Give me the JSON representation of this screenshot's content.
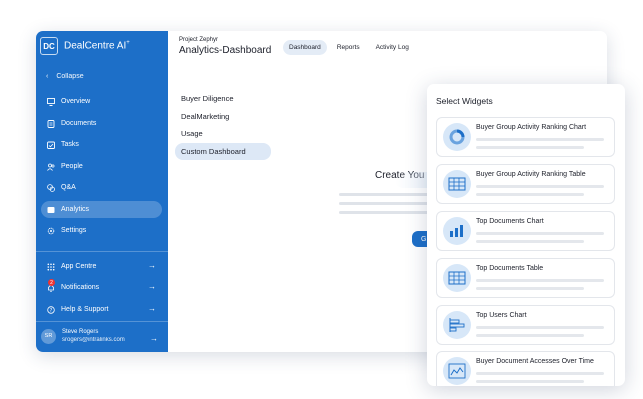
{
  "app": {
    "logo_initials": "DC",
    "logo_name": "DealCentre AI",
    "logo_sup": "+",
    "collapse": "Collapse"
  },
  "sidebar": {
    "items": [
      {
        "label": "Overview",
        "icon": "monitor-icon"
      },
      {
        "label": "Documents",
        "icon": "document-icon"
      },
      {
        "label": "Tasks",
        "icon": "tasks-icon"
      },
      {
        "label": "People",
        "icon": "people-icon"
      },
      {
        "label": "Q&A",
        "icon": "chat-icon"
      },
      {
        "label": "Analytics",
        "icon": "analytics-icon",
        "active": true
      },
      {
        "label": "Settings",
        "icon": "gear-icon"
      }
    ],
    "bottom": [
      {
        "label": "App Centre",
        "icon": "grid-icon"
      },
      {
        "label": "Notifications",
        "icon": "bell-icon",
        "badge": "2"
      },
      {
        "label": "Help & Support",
        "icon": "help-icon"
      }
    ],
    "user": {
      "initials": "SR",
      "name": "Steve Rogers",
      "email": "srogers@intralinks.com"
    }
  },
  "header": {
    "project": "Project Zephyr",
    "title": "Analytics-Dashboard",
    "tabs": [
      "Dashboard",
      "Reports",
      "Activity Log"
    ],
    "active_tab": "Dashboard"
  },
  "dashboards": [
    "Buyer Diligence",
    "DealMarketing",
    "Usage",
    "Custom Dashboard"
  ],
  "active_dashboard": "Custom Dashboard",
  "main": {
    "create_heading": "Create You",
    "button_text": "G"
  },
  "panel": {
    "title": "Select Widgets",
    "widgets": [
      {
        "label": "Buyer Group Activity Ranking Chart",
        "icon": "donut-chart-icon"
      },
      {
        "label": "Buyer Group Activity Ranking Table",
        "icon": "table-icon"
      },
      {
        "label": "Top Documents Chart",
        "icon": "bar-chart-icon"
      },
      {
        "label": "Top Documents Table",
        "icon": "table-icon"
      },
      {
        "label": "Top Users Chart",
        "icon": "horizontal-bar-chart-icon"
      },
      {
        "label": "Buyer Document Accesses Over Time",
        "icon": "line-chart-icon"
      }
    ]
  },
  "colors": {
    "sidebar": "#1d6fc8",
    "accent": "#1d6fc8",
    "active_tab_bg": "#e4ecf6",
    "widget_icon_bg": "#d7e7f8"
  }
}
